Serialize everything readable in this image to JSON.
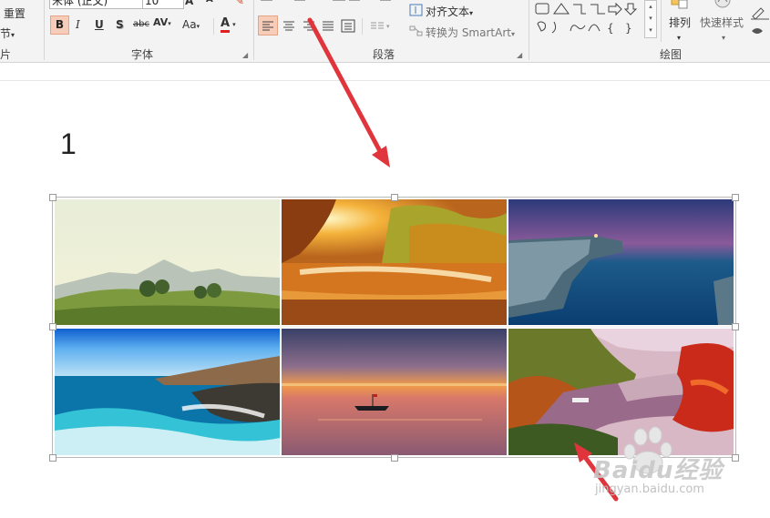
{
  "ribbon": {
    "clipboard": {
      "reset": "重置",
      "section": "节",
      "label_fragment": "片"
    },
    "font": {
      "name": "宋体 (正文)",
      "size": "10",
      "label": "字体",
      "buttons": {
        "bold": "B",
        "italic": "I",
        "underline": "U",
        "shadow": "S",
        "strike": "abc",
        "spacing": "AV",
        "case": "Aa",
        "color": "A"
      }
    },
    "paragraph": {
      "label": "段落",
      "align_text": "对齐文本",
      "smartart": "转换为 SmartArt"
    },
    "drawing": {
      "label": "绘图",
      "arrange": "排列",
      "quick_styles": "快速样式"
    }
  },
  "slide": {
    "number": "1"
  },
  "watermark": {
    "brand": "Baidu经验",
    "url": "jingyan.baidu.com"
  },
  "colors": {
    "arrow": "#e0353c",
    "accent": "#d24726"
  }
}
